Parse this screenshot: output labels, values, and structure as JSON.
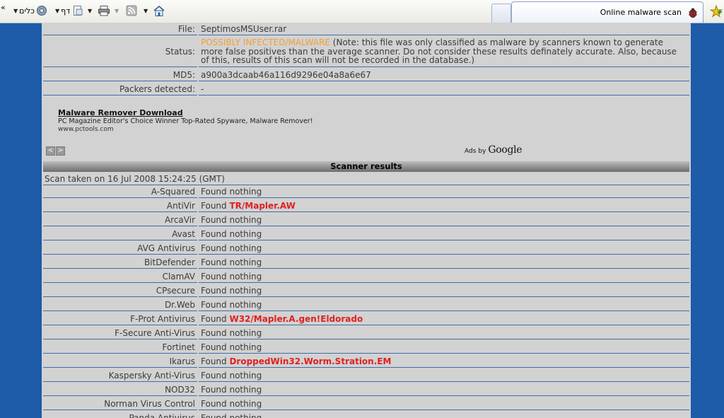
{
  "toolbar": {
    "chevrons": "«",
    "tools_label": "כלים",
    "page_label": "דף",
    "tab_title": "Online malware scan"
  },
  "file_info": {
    "file_label": "File:",
    "file_value": "SeptimosMSUser.rar",
    "status_label": "Status:",
    "status_value": "POSSIBLY INFECTED/MALWARE",
    "status_note": " (Note: this file was only classified as malware by scanners known to generate more false positives than the average scanner. Do not consider these results definately accurate. Also, because of this, results of this scan will not be recorded in the database.)",
    "md5_label": "MD5:",
    "md5_value": "a900a3dcaab46a116d9296e04a8a6e67",
    "packers_label": "Packers detected:",
    "packers_value": "-"
  },
  "ad": {
    "title": "Malware Remover Download",
    "description": "PC Magazine Editor's Choice Winner Top-Rated Spyware, Malware Remover!",
    "url": "www.pctools.com",
    "ads_by": "Ads by",
    "google": "Google",
    "prev": "<",
    "next": ">"
  },
  "scanner": {
    "header": "Scanner results",
    "scan_taken": "Scan taken on 16 Jul 2008 15:24:25 (GMT)",
    "results": [
      {
        "name": "A-Squared",
        "prefix": "Found nothing",
        "threat": ""
      },
      {
        "name": "AntiVir",
        "prefix": "Found ",
        "threat": "TR/Mapler.AW"
      },
      {
        "name": "ArcaVir",
        "prefix": "Found nothing",
        "threat": ""
      },
      {
        "name": "Avast",
        "prefix": "Found nothing",
        "threat": ""
      },
      {
        "name": "AVG Antivirus",
        "prefix": "Found nothing",
        "threat": ""
      },
      {
        "name": "BitDefender",
        "prefix": "Found nothing",
        "threat": ""
      },
      {
        "name": "ClamAV",
        "prefix": "Found nothing",
        "threat": ""
      },
      {
        "name": "CPsecure",
        "prefix": "Found nothing",
        "threat": ""
      },
      {
        "name": "Dr.Web",
        "prefix": "Found nothing",
        "threat": ""
      },
      {
        "name": "F-Prot Antivirus",
        "prefix": "Found ",
        "threat": "W32/Mapler.A.gen!Eldorado"
      },
      {
        "name": "F-Secure Anti-Virus",
        "prefix": "Found nothing",
        "threat": ""
      },
      {
        "name": "Fortinet",
        "prefix": "Found nothing",
        "threat": ""
      },
      {
        "name": "Ikarus",
        "prefix": "Found ",
        "threat": "DroppedWin32.Worm.Stration.EM"
      },
      {
        "name": "Kaspersky Anti-Virus",
        "prefix": "Found nothing",
        "threat": ""
      },
      {
        "name": "NOD32",
        "prefix": "Found nothing",
        "threat": ""
      },
      {
        "name": "Norman Virus Control",
        "prefix": "Found nothing",
        "threat": ""
      },
      {
        "name": "Panda Antivirus",
        "prefix": "Found nothing",
        "threat": ""
      }
    ]
  },
  "colors": {
    "page_background": "#1e5ba8",
    "panel": "#d2d2d2",
    "infected": "#f3a033",
    "threat": "#e02020",
    "row_border": "#3f6ea8"
  }
}
